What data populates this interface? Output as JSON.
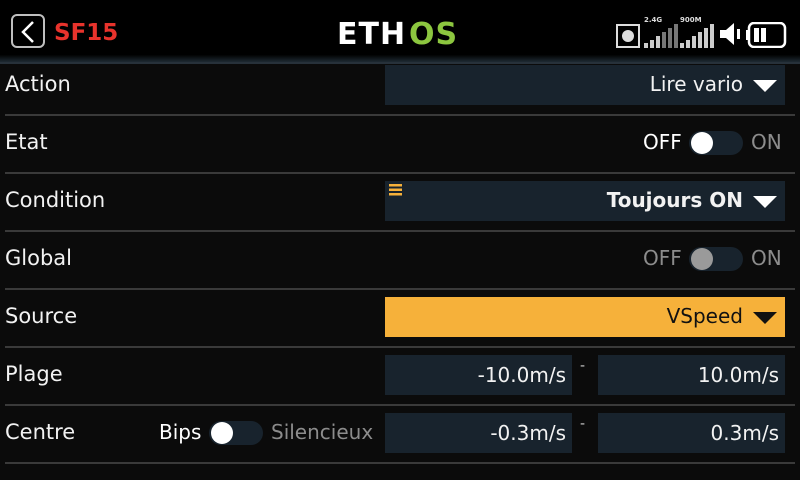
{
  "header": {
    "title": "SF15",
    "logo_text": "ETHOS",
    "rf_label_1": "2.4G",
    "rf_label_2": "900M"
  },
  "rows": {
    "action": {
      "label": "Action",
      "value": "Lire vario"
    },
    "etat": {
      "label": "Etat",
      "off": "OFF",
      "on": "ON"
    },
    "condition": {
      "label": "Condition",
      "value": "Toujours ON"
    },
    "global": {
      "label": "Global",
      "off": "OFF",
      "on": "ON"
    },
    "source": {
      "label": "Source",
      "value": "VSpeed"
    },
    "plage": {
      "label": "Plage",
      "min": "-10.0m/s",
      "sep": "-",
      "max": "10.0m/s"
    },
    "centre": {
      "label": "Centre",
      "left_option": "Bips",
      "right_option": "Silencieux",
      "min": "-0.3m/s",
      "sep": "-",
      "max": "0.3m/s"
    }
  },
  "colors": {
    "accent": "#f6b13a",
    "title_red": "#e8332c",
    "field_bg": "#18232d",
    "logo_green": "#8cc63f"
  }
}
